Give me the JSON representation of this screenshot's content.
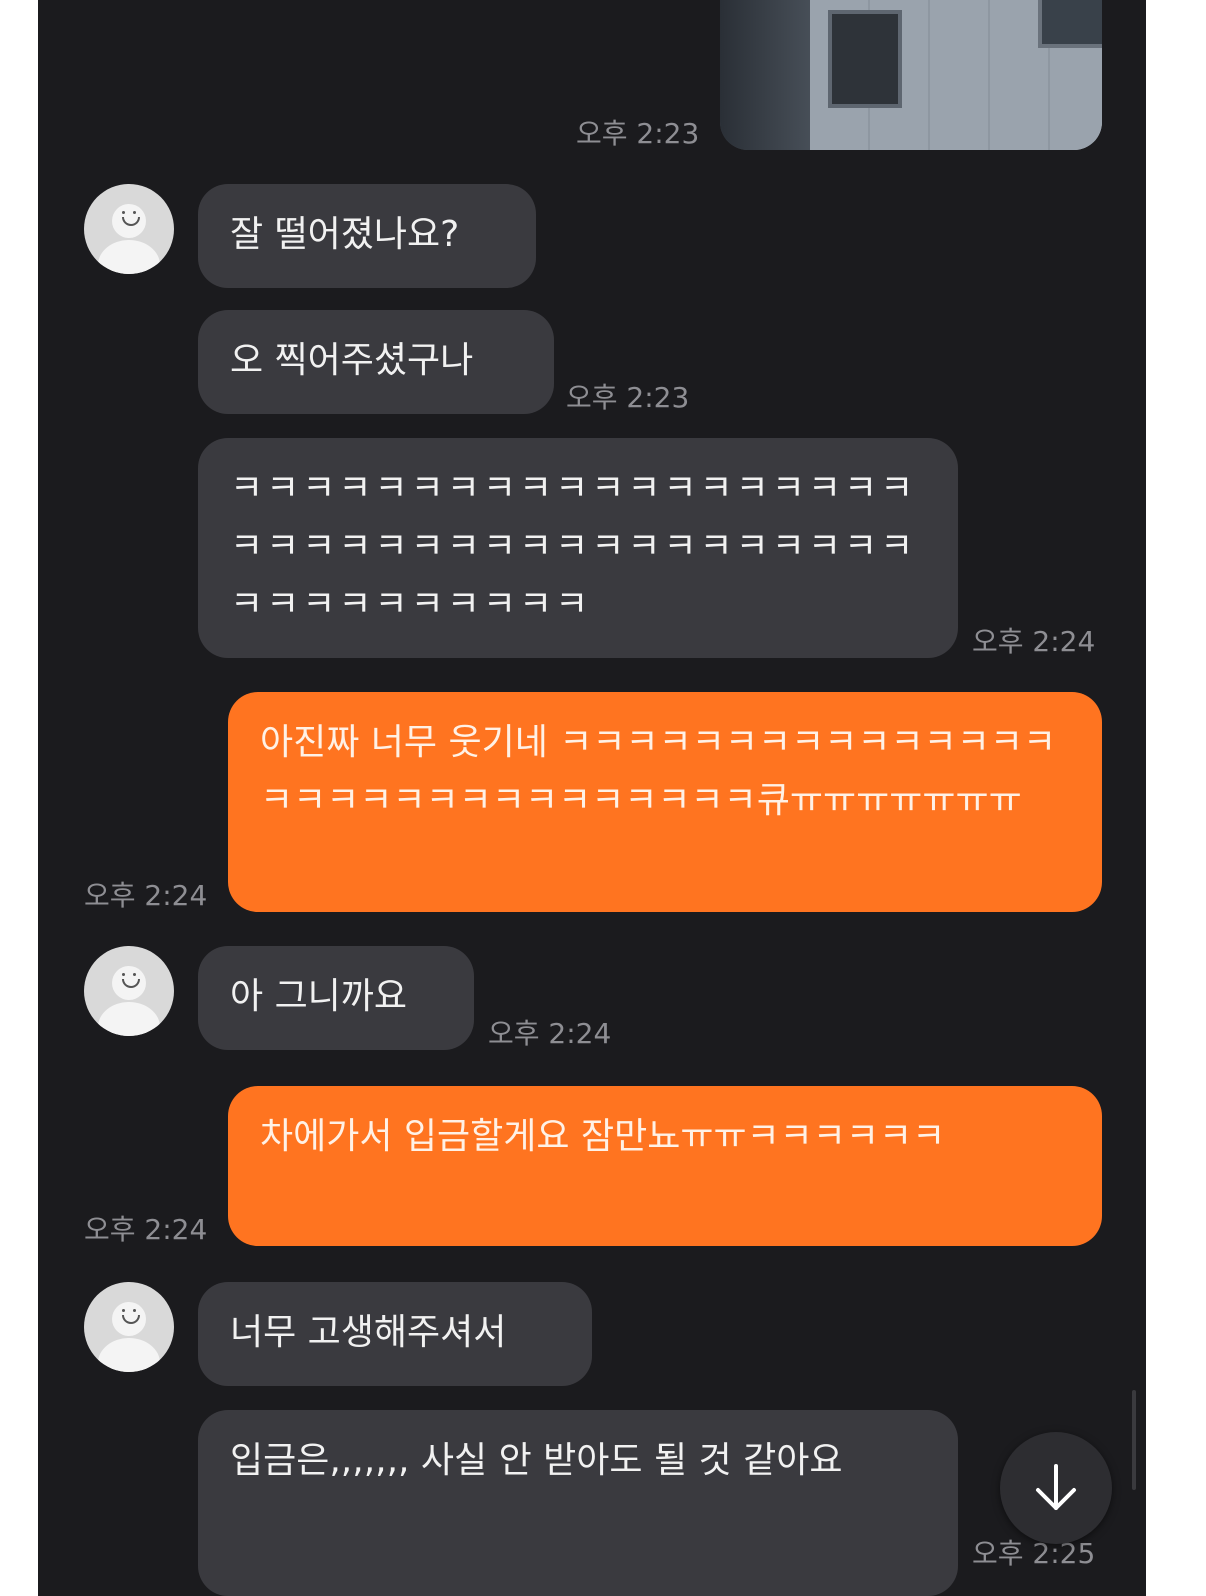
{
  "messages": [
    {
      "text": "잘 떨어졌나요?"
    },
    {
      "text": "오 찍어주셨구나",
      "time": "오후 2:23"
    },
    {
      "text": "ㅋㅋㅋㅋㅋㅋㅋㅋㅋㅋㅋㅋㅋㅋㅋㅋㅋㅋㅋㅋㅋㅋㅋㅋㅋㅋㅋㅋㅋㅋㅋㅋㅋㅋㅋㅋㅋㅋㅋㅋㅋㅋㅋㅋㅋㅋㅋㅋ",
      "time": "오후 2:24"
    },
    {
      "text": "아진짜 너무 웃기네 ㅋㅋㅋㅋㅋㅋㅋㅋㅋㅋㅋㅋㅋㅋㅋㅋㅋㅋㅋㅋㅋㅋㅋㅋㅋㅋㅋㅋㅋㅋ큐ㅠㅠㅠㅠㅠㅠㅠ",
      "time": "오후 2:24"
    },
    {
      "text": "아 그니까요",
      "time": "오후 2:24"
    },
    {
      "text": "차에가서 입금할게요 잠만뇨ㅠㅠㅋㅋㅋㅋㅋㅋ",
      "time": "오후 2:24"
    },
    {
      "text": "너무 고생해주셔서"
    },
    {
      "text": "입금은,,,,,,, 사실 안 받아도 될 것 같아요",
      "time": "오후 2:25"
    }
  ],
  "photo_time": "오후 2:23",
  "icons": {
    "avatar": "default-profile-icon",
    "scroll_down": "arrow-down-icon",
    "photo": "building-photo"
  },
  "colors": {
    "background": "#1b1b1e",
    "incoming_bubble": "#3a3a3f",
    "outgoing_bubble": "#ff7420",
    "timestamp": "#8e8e93"
  }
}
